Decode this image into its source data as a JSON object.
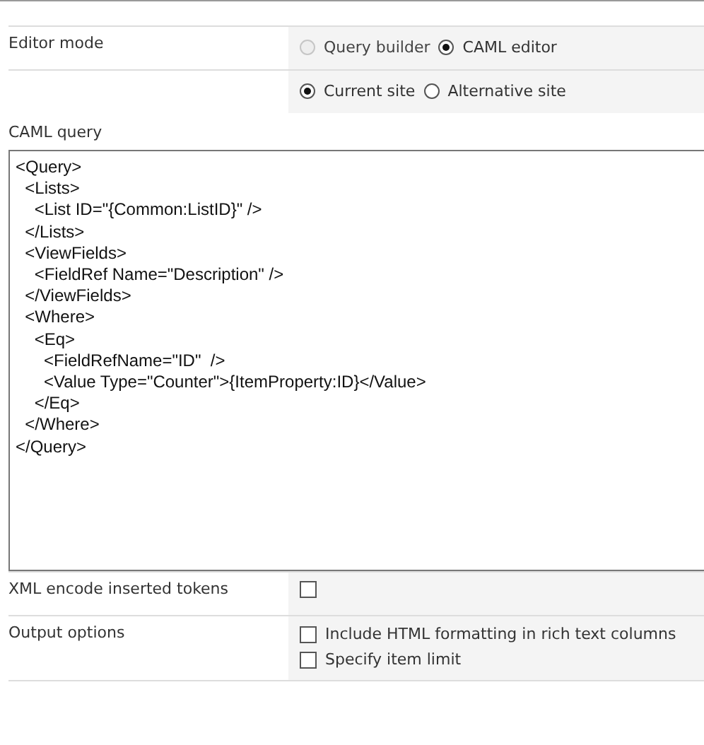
{
  "rows": [
    {
      "kind": "radios",
      "label": "Editor mode",
      "options": [
        {
          "label": "Query builder",
          "selected": false,
          "disabled": true
        },
        {
          "label": "CAML editor",
          "selected": true,
          "disabled": false
        }
      ]
    },
    {
      "kind": "radios",
      "options": [
        {
          "label": "Current site",
          "selected": true,
          "disabled": false
        },
        {
          "label": "Alternative site",
          "selected": false,
          "disabled": false
        }
      ]
    }
  ],
  "query": {
    "label": "CAML query",
    "value": "<Query>\n  <Lists>\n    <List ID=\"{Common:ListID}\" />\n  </Lists>\n  <ViewFields>\n    <FieldRef Name=\"Description\" />\n  </ViewFields>\n  <Where>\n    <Eq>\n      <FieldRefName=\"ID\"  />\n      <Value Type=\"Counter\">{ItemProperty:ID}</Value>\n    </Eq>\n  </Where>\n</Query>"
  },
  "options": [
    {
      "kind": "checks",
      "label": "XML encode inserted tokens",
      "options": [
        {
          "checked": false
        }
      ]
    },
    {
      "kind": "checks",
      "label": "Output options",
      "options": [
        {
          "label": "Include HTML formatting in rich text columns",
          "checked": false
        },
        {
          "label": "Specify item limit",
          "checked": false
        }
      ]
    }
  ]
}
